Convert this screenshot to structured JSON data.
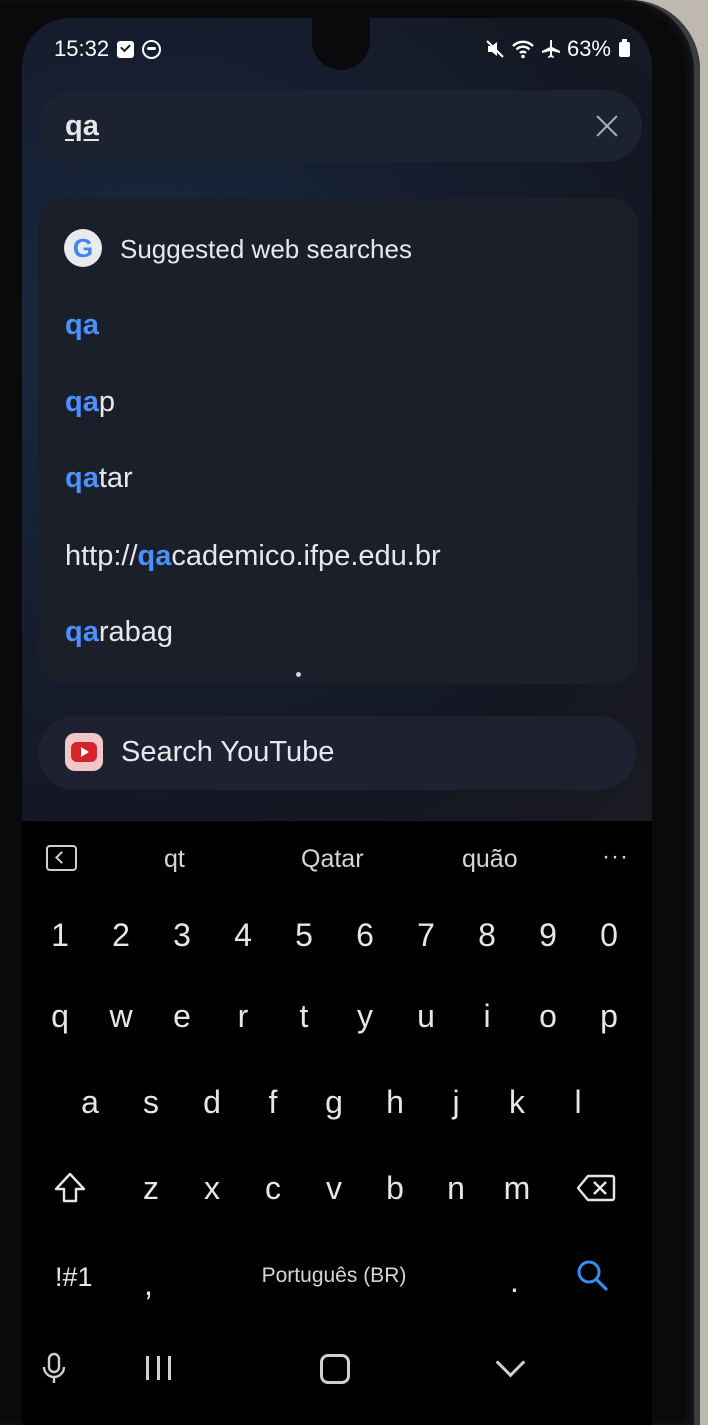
{
  "status_bar": {
    "time": "15:32",
    "battery": "63%",
    "icons": [
      "check-square-icon",
      "circle-status-icon",
      "mute-icon",
      "wifi-icon",
      "airplane-icon",
      "battery-icon"
    ]
  },
  "search": {
    "query": "qa",
    "clear_icon": "close-icon"
  },
  "suggestions": {
    "title": "Suggested web searches",
    "items": [
      {
        "prefix": "",
        "highlight": "qa",
        "rest": ""
      },
      {
        "prefix": "",
        "highlight": "qa",
        "rest": "p"
      },
      {
        "prefix": "",
        "highlight": "qa",
        "rest": "tar"
      },
      {
        "prefix": "http://",
        "highlight": "qa",
        "rest": "cademico.ifpe.edu.br"
      },
      {
        "prefix": "",
        "highlight": "qa",
        "rest": "rabag"
      }
    ],
    "highlight_color": "#4a90ff"
  },
  "youtube": {
    "label": "Search YouTube"
  },
  "keyboard": {
    "predictions": [
      "qt",
      "Qatar",
      "quão"
    ],
    "more_label": "···",
    "numbers": [
      "1",
      "2",
      "3",
      "4",
      "5",
      "6",
      "7",
      "8",
      "9",
      "0"
    ],
    "row1": [
      "q",
      "w",
      "e",
      "r",
      "t",
      "y",
      "u",
      "i",
      "o",
      "p"
    ],
    "row2": [
      "a",
      "s",
      "d",
      "f",
      "g",
      "h",
      "j",
      "k",
      "l"
    ],
    "row3": [
      "z",
      "x",
      "c",
      "v",
      "b",
      "n",
      "m"
    ],
    "symbols_label": "!#1",
    "comma_label": ",",
    "space_label": "Português (BR)",
    "period_label": ".",
    "action_color": "#3b8cf0"
  }
}
